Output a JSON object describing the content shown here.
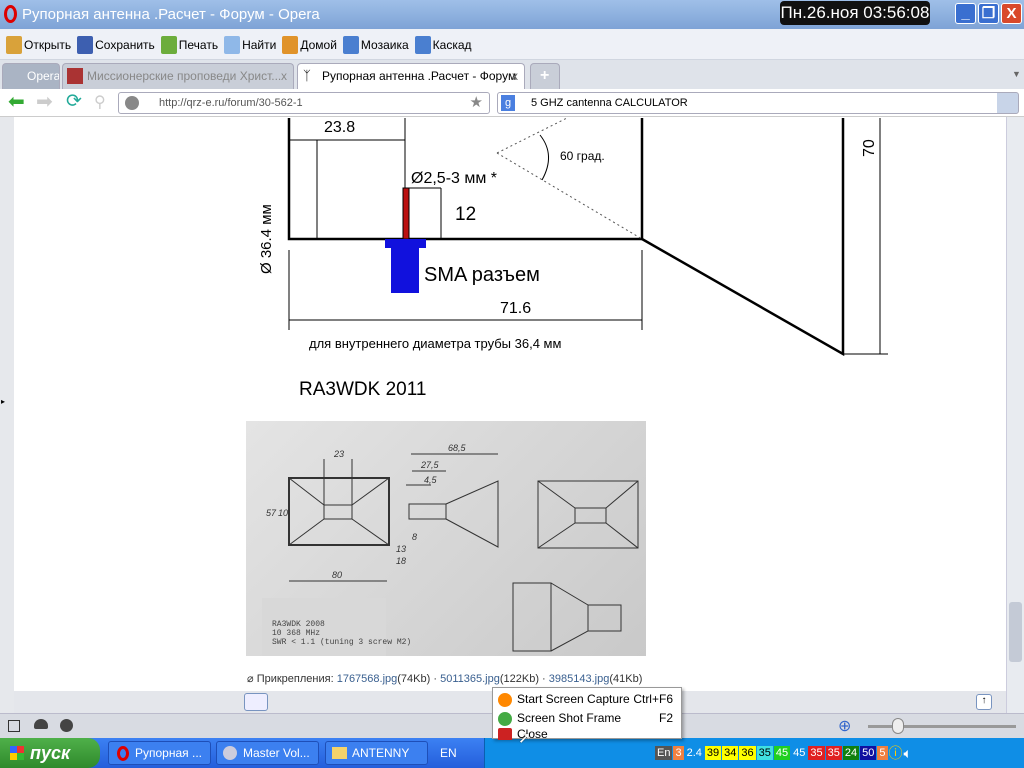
{
  "window": {
    "title": "Рупорная антенна .Расчет - Форум - Opera",
    "clock": "Пн.26.ноя 03:56:08",
    "min": "_",
    "max": "❐",
    "close": "X"
  },
  "toolbar": [
    {
      "label": "Открыть",
      "color": "#d9a23a"
    },
    {
      "label": "Сохранить",
      "color": "#3d5fb0"
    },
    {
      "label": "Печать",
      "color": "#6cad3c"
    },
    {
      "label": "Найти",
      "color": "#8fb8e8"
    },
    {
      "label": "Домой",
      "color": "#e0932a"
    },
    {
      "label": "Мозаика",
      "color": "#4a7fd0"
    },
    {
      "label": "Каскад",
      "color": "#4a7fd0"
    }
  ],
  "tabs": {
    "opera": "Opera",
    "tab1": "Миссионерские проповеди Христ...",
    "tab2": "Рупорная антенна .Расчет - Форум",
    "close": "x",
    "new": "+",
    "menu": "▼"
  },
  "nav": {
    "url": "http://qrz-e.ru/forum/30-562-1",
    "search": "5 GHZ cantenna CALCULATOR"
  },
  "drawing": {
    "dim_238": "23.8",
    "diam": "Ø 36.4 мм",
    "probe": "Ø2,5-3 мм *",
    "dim_12": "12",
    "angle": "60 град.",
    "dim_70": "70",
    "connector": "SMA разъем",
    "dim_716": "71.6",
    "note": "для внутреннего диаметра трубы 36,4 мм",
    "author": "RA3WDK 2011"
  },
  "photo": {
    "d23": "23",
    "d685": "68,5",
    "d275": "27,5",
    "d45": "4,5",
    "d57": "57",
    "d10": "10",
    "d8": "8",
    "d13": "13",
    "d18": "18",
    "d80": "80",
    "l1": "RA3WDK  2008",
    "l2": "10 368 MHz",
    "l3": "SWR < 1.1 (tuning 3 screw M2)"
  },
  "attachments": {
    "label": "Прикрепления:",
    "files": [
      {
        "name": "1767568.jpg",
        "size": "(74Kb)"
      },
      {
        "name": "5011365.jpg",
        "size": "(122Kb)"
      },
      {
        "name": "3985143.jpg",
        "size": "(41Kb)"
      }
    ],
    "sep": "·"
  },
  "context_menu": [
    {
      "label": "Start Screen Capture",
      "key": "Ctrl+F6"
    },
    {
      "label": "Screen Shot Frame",
      "key": "F2"
    },
    {
      "label": "Close",
      "key": ""
    }
  ],
  "taskbar": {
    "start": "пуск",
    "tasks": [
      "Рупорная ...",
      "Master Vol...",
      "ANTENNY"
    ],
    "lang": "EN",
    "tray_lang": "En",
    "badges": [
      {
        "v": "3",
        "c": "#f08040"
      },
      {
        "v": "2.4",
        "c": "#0f8ee6"
      },
      {
        "v": "39",
        "c": "#ffff00"
      },
      {
        "v": "34",
        "c": "#ffff00"
      },
      {
        "v": "36",
        "c": "#ffff00"
      },
      {
        "v": "35",
        "c": "#40e0e0"
      },
      {
        "v": "45",
        "c": "#20d020"
      },
      {
        "v": "45",
        "c": "#0f8ee6"
      },
      {
        "v": "35",
        "c": "#e02020"
      },
      {
        "v": "35",
        "c": "#e02020"
      },
      {
        "v": "24",
        "c": "#108010"
      },
      {
        "v": "50",
        "c": "#1010a0"
      },
      {
        "v": "5",
        "c": "#f08040"
      }
    ]
  },
  "zoom": {
    "level": 0.2
  }
}
